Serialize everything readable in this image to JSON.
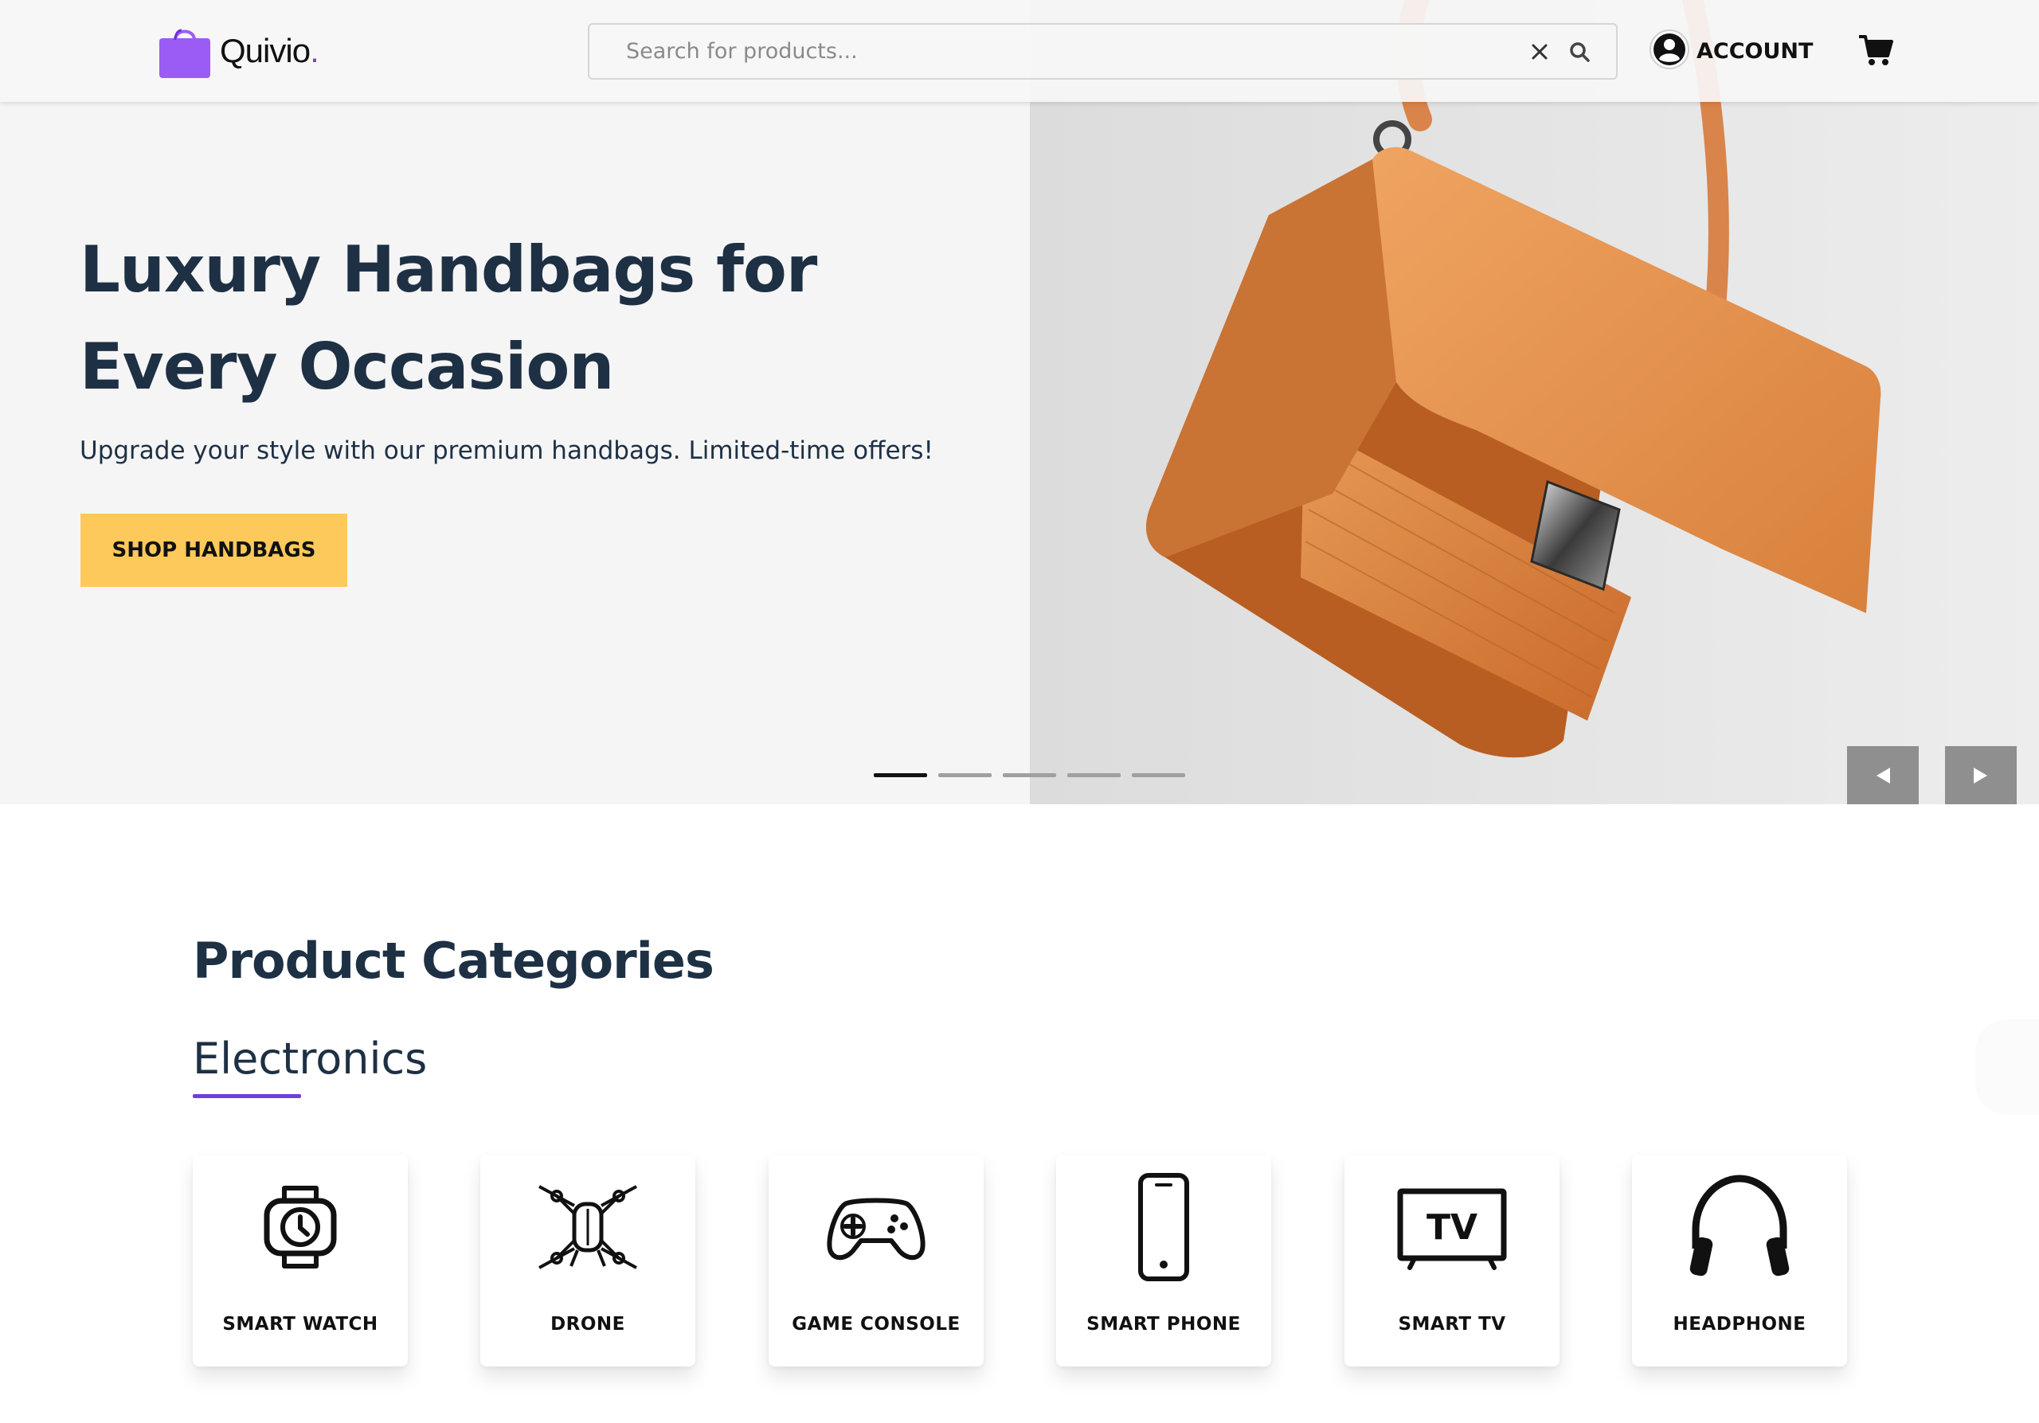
{
  "header": {
    "logo_text": "Quivio",
    "logo_dot": ".",
    "search_placeholder": "Search for products...",
    "account_label": "ACCOUNT",
    "icons": [
      "shopping-bag-icon",
      "close-icon",
      "search-icon",
      "user-circle-icon",
      "cart-icon"
    ]
  },
  "hero": {
    "title_line1": "Luxury Handbags for",
    "title_line2": "Every Occasion",
    "subtitle": "Upgrade your style with our premium handbags. Limited-time offers!",
    "cta_label": "SHOP HANDBAGS",
    "slides_total": 5,
    "active_slide": 1,
    "cta_color": "#fcc95a"
  },
  "categories": {
    "title": "Product Categories",
    "active_tab": "Electronics",
    "accent_color": "#6a3fe0",
    "items": [
      {
        "label": "SMART WATCH",
        "icon": "smart-watch-icon"
      },
      {
        "label": "DRONE",
        "icon": "drone-icon"
      },
      {
        "label": "GAME CONSOLE",
        "icon": "game-controller-icon"
      },
      {
        "label": "SMART PHONE",
        "icon": "smartphone-icon"
      },
      {
        "label": "SMART TV",
        "icon": "tv-icon"
      },
      {
        "label": "HEADPHONE",
        "icon": "headphone-icon"
      }
    ]
  }
}
